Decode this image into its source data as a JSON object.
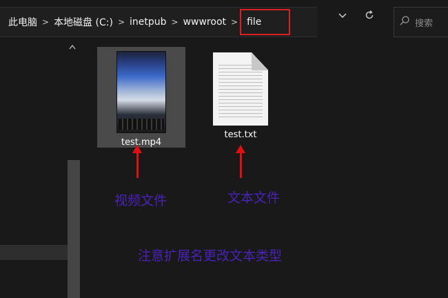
{
  "breadcrumb": {
    "items": [
      "此电脑",
      "本地磁盘 (C:)",
      "inetpub",
      "wwwroot",
      "file"
    ],
    "separator": ">"
  },
  "search": {
    "placeholder": "搜索"
  },
  "files": [
    {
      "name": "test.mp4",
      "type": "video",
      "selected": true
    },
    {
      "name": "test.txt",
      "type": "text",
      "selected": false
    }
  ],
  "annotations": {
    "video_caption": "视频文件",
    "text_caption": "文本文件",
    "note": "注意扩展名更改文本类型"
  },
  "colors": {
    "highlight_box": "#e02020",
    "arrow": "#e01010",
    "annotation_text": "#4a22b8",
    "background": "#191919"
  },
  "icons": {
    "dropdown": "chevron-down-icon",
    "refresh": "refresh-icon",
    "search": "search-icon"
  }
}
